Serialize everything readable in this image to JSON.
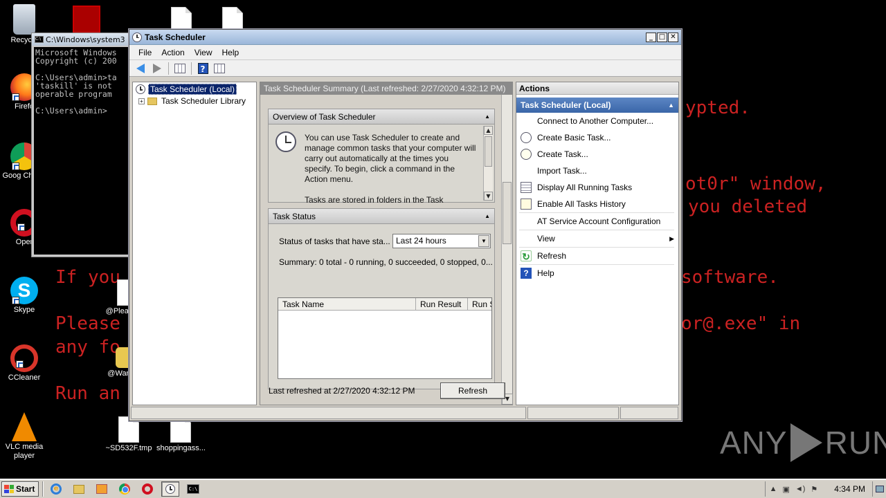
{
  "desktop": {
    "background_text": [
      {
        "text": "ypted.",
        "color": "red"
      },
      {
        "text": "ot0r\" window,",
        "color": "red"
      },
      {
        "text": "you deleted",
        "color": "red"
      },
      {
        "text": "If you",
        "color": "red"
      },
      {
        "text": "software.",
        "color": "red"
      },
      {
        "text": "Please",
        "color": "red"
      },
      {
        "text": "or@.exe\" in",
        "color": "red"
      },
      {
        "text": "any fo",
        "color": "red"
      },
      {
        "text": "Run an",
        "color": "red"
      }
    ],
    "icons": [
      {
        "label": "Recycle",
        "icon": "recycle-bin-icon"
      },
      {
        "label": "Firefo",
        "icon": "firefox-icon"
      },
      {
        "label": "Goog Chrom",
        "icon": "chrome-icon"
      },
      {
        "label": "Oper",
        "icon": "opera-icon"
      },
      {
        "label": "Skype",
        "icon": "skype-icon"
      },
      {
        "label": "CCleaner",
        "icon": "ccleaner-icon"
      },
      {
        "label": "VLC media player",
        "icon": "vlc-icon"
      },
      {
        "label": "@Pleas",
        "icon": "file-icon"
      },
      {
        "label": "@Wan",
        "icon": "wanna-icon"
      },
      {
        "label": "~SD532F.tmp",
        "icon": "file-icon"
      },
      {
        "label": "shoppingass...",
        "icon": "file-icon"
      }
    ],
    "watermark": {
      "left": "ANY",
      "right": "RUN"
    }
  },
  "cmd": {
    "title": "C:\\Windows\\system3",
    "lines": "Microsoft Windows\nCopyright (c) 200\n\nC:\\Users\\admin>ta\n'taskill' is not\noperable program\n\nC:\\Users\\admin>"
  },
  "window": {
    "title": "Task Scheduler",
    "menu": [
      "File",
      "Action",
      "View",
      "Help"
    ],
    "tree": {
      "root": "Task Scheduler (Local)",
      "child": "Task Scheduler Library"
    },
    "summary_header": "Task Scheduler Summary (Last refreshed: 2/27/2020 4:32:12 PM)",
    "overview": {
      "title": "Overview of Task Scheduler",
      "text": "You can use Task Scheduler to create and manage common tasks that your computer will carry out automatically at the times you specify. To begin, click a command in the Action menu.",
      "text2": "Tasks are stored in folders in the Task"
    },
    "task_status": {
      "title": "Task Status",
      "label": "Status of tasks that have sta...",
      "dropdown_value": "Last 24 hours",
      "summary": "Summary: 0 total - 0 running, 0 succeeded, 0 stopped, 0...",
      "columns": [
        "Task Name",
        "Run Result",
        "Run S"
      ]
    },
    "last_refreshed": "Last refreshed at 2/27/2020 4:32:12 PM",
    "refresh_button": "Refresh",
    "actions": {
      "header": "Actions",
      "group": "Task Scheduler (Local)",
      "items": [
        {
          "label": "Connect to Another Computer...",
          "icon": ""
        },
        {
          "label": "Create Basic Task...",
          "icon": "clock-icon"
        },
        {
          "label": "Create Task...",
          "icon": "clock-plus-icon"
        },
        {
          "label": "Import Task...",
          "icon": ""
        },
        {
          "label": "Display All Running Tasks",
          "icon": "list-icon"
        },
        {
          "label": "Enable All Tasks History",
          "icon": "history-icon"
        },
        {
          "label": "AT Service Account Configuration",
          "icon": ""
        },
        {
          "label": "View",
          "icon": "",
          "submenu": true
        },
        {
          "label": "Refresh",
          "icon": "refresh-icon"
        },
        {
          "label": "Help",
          "icon": "help-icon"
        }
      ]
    }
  },
  "taskbar": {
    "start_label": "Start",
    "clock": "4:34 PM"
  }
}
